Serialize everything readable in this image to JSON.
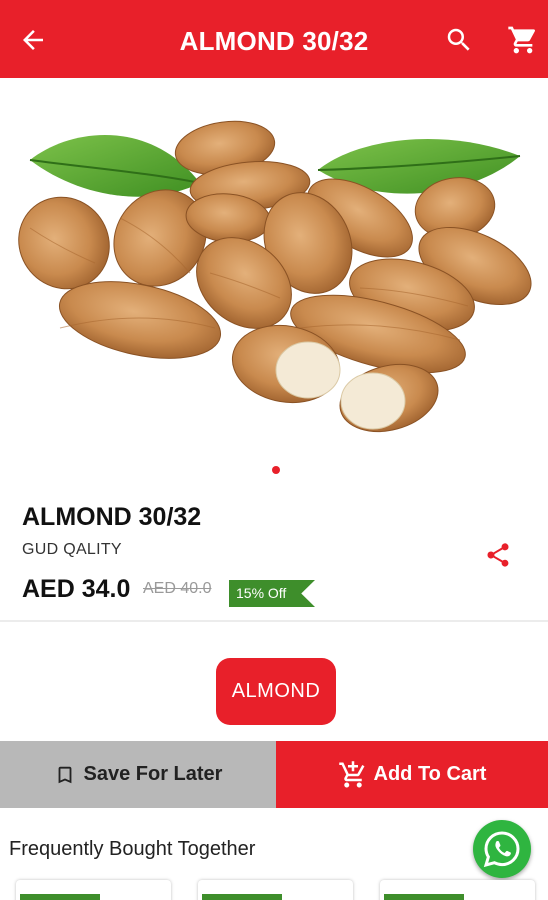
{
  "appbar": {
    "title": "ALMOND 30/32",
    "color": "#e8202a",
    "icons": [
      "arrow-back-icon",
      "search-icon",
      "cart-icon"
    ]
  },
  "gallery": {
    "image": "almonds-with-leaves",
    "page_count": 1,
    "active_page": 1
  },
  "product": {
    "name": "ALMOND 30/32",
    "subtitle": "GUD QALITY",
    "price": "AED 34.0",
    "old_price": "AED 40.0",
    "discount": "15% Off",
    "discount_color": "#3e8e2b"
  },
  "category_chip": "ALMOND",
  "actions": {
    "save_label": "Save For Later",
    "add_label": "Add To Cart"
  },
  "related": {
    "title": "Frequently Bought Together"
  }
}
